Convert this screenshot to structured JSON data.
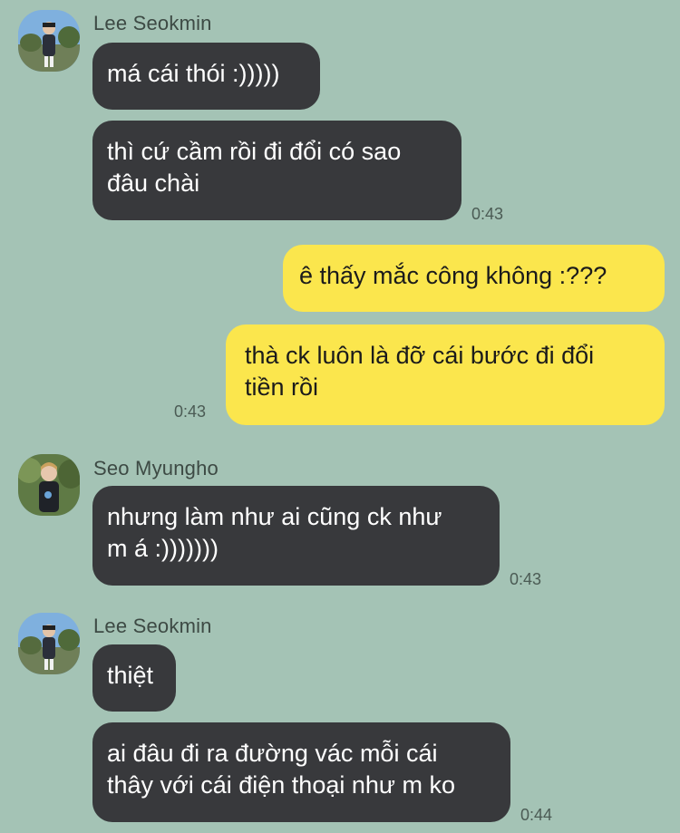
{
  "colors": {
    "background": "#a4c3b5",
    "incoming_bubble": "#38393c",
    "outgoing_bubble": "#fbe64d"
  },
  "groups": [
    {
      "sender": "Lee Seokmin",
      "avatar": "avatar-lee-seokmin",
      "messages": [
        {
          "lines": [
            "má cái thói :)))))"
          ]
        },
        {
          "lines": [
            "thì cứ cầm rồi đi đổi có sao",
            "đâu chài"
          ],
          "time": "0:43"
        }
      ]
    },
    {
      "sender": "me",
      "messages": [
        {
          "lines": [
            "ê thấy mắc công không :???"
          ]
        },
        {
          "lines": [
            "thà ck luôn là đỡ cái bước đi đổi",
            "tiền rồi"
          ],
          "time": "0:43"
        }
      ]
    },
    {
      "sender": "Seo Myungho",
      "avatar": "avatar-seo-myungho",
      "messages": [
        {
          "lines": [
            "nhưng làm như ai cũng ck như",
            "m á :)))))))"
          ],
          "time": "0:43"
        }
      ]
    },
    {
      "sender": "Lee Seokmin",
      "avatar": "avatar-lee-seokmin",
      "messages": [
        {
          "lines": [
            "thiệt"
          ]
        },
        {
          "lines": [
            "ai đâu đi ra đường vác mỗi cái",
            "thây với cái điện thoại như m ko"
          ],
          "time": "0:44"
        }
      ]
    }
  ]
}
